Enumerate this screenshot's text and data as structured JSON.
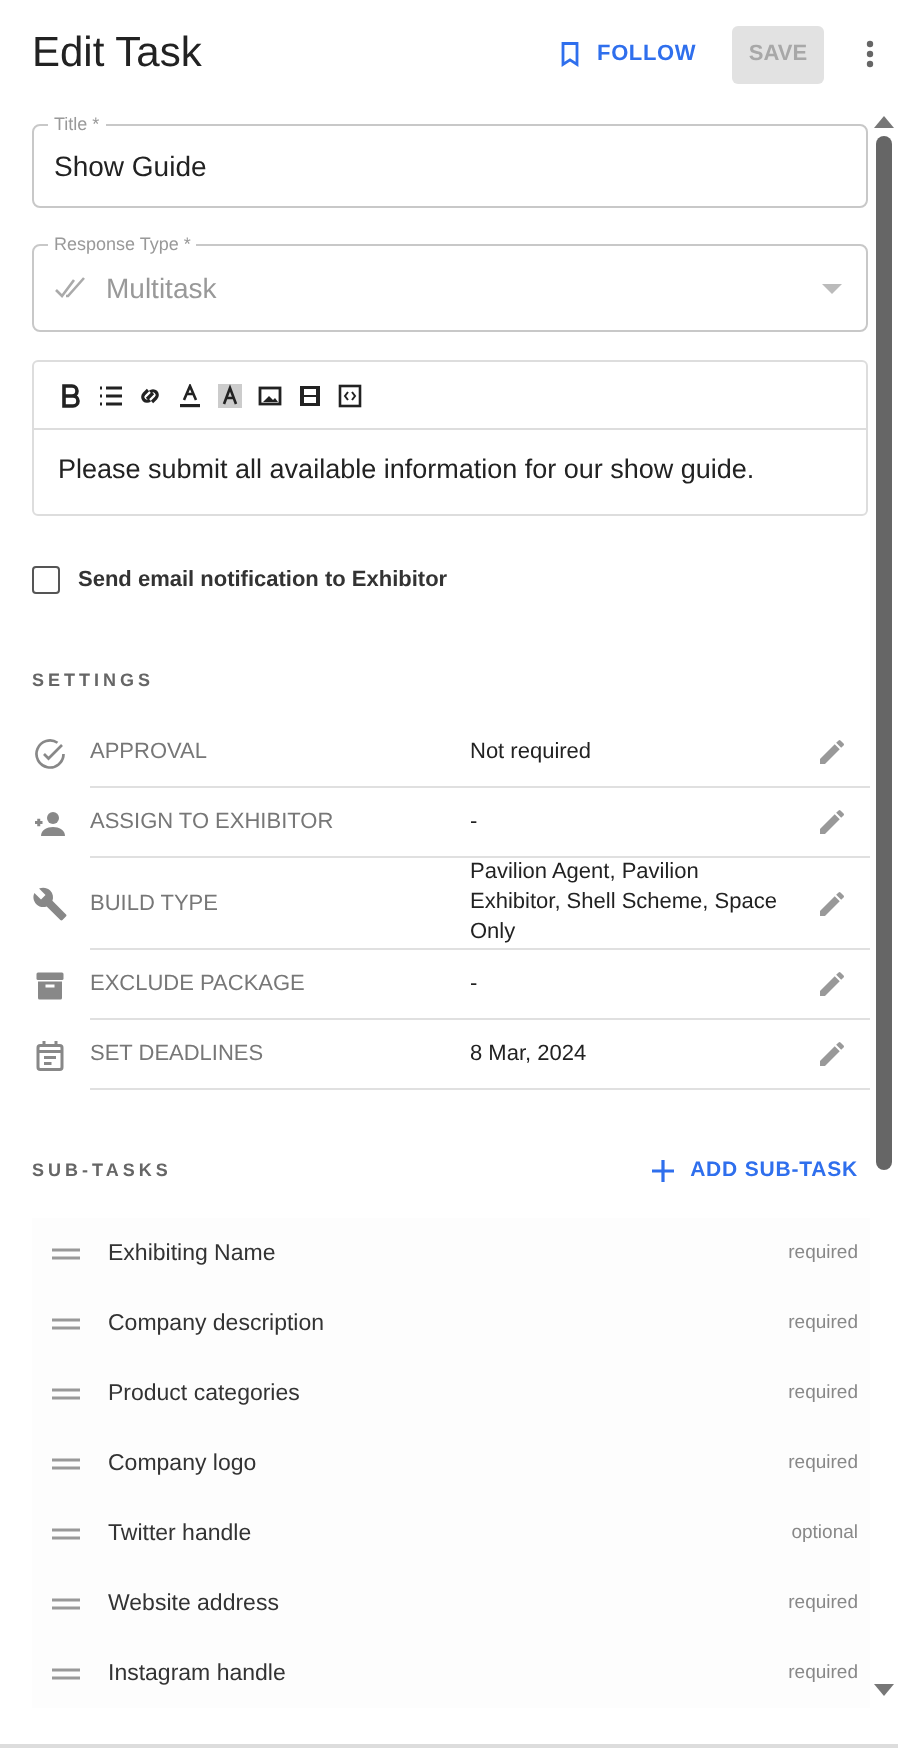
{
  "header": {
    "title": "Edit Task",
    "follow": "FOLLOW",
    "save": {
      "label": "SAVE",
      "disabled": true
    }
  },
  "title_field": {
    "label": "Title *",
    "value": "Show Guide"
  },
  "response_type": {
    "label": "Response Type *",
    "value": "Multitask",
    "disabled": true
  },
  "description": "Please submit all available information for our show guide.",
  "notify": {
    "label": "Send email notification to Exhibitor",
    "checked": false
  },
  "settings": {
    "heading": "SETTINGS",
    "rows": [
      {
        "label": "APPROVAL",
        "value": "Not required"
      },
      {
        "label": "ASSIGN TO EXHIBITOR",
        "value": "-"
      },
      {
        "label": "BUILD TYPE",
        "value": "Pavilion Agent, Pavilion Exhibitor, Shell Scheme, Space Only"
      },
      {
        "label": "EXCLUDE PACKAGE",
        "value": "-"
      },
      {
        "label": "SET DEADLINES",
        "value": "8 Mar, 2024"
      }
    ]
  },
  "subtasks": {
    "heading": "SUB-TASKS",
    "add": "ADD SUB-TASK",
    "items": [
      {
        "name": "Exhibiting Name",
        "status": "required"
      },
      {
        "name": "Company description",
        "status": "required"
      },
      {
        "name": "Product categories",
        "status": "required"
      },
      {
        "name": "Company logo",
        "status": "required"
      },
      {
        "name": "Twitter handle",
        "status": "optional"
      },
      {
        "name": "Website address",
        "status": "required"
      },
      {
        "name": "Instagram handle",
        "status": "required"
      }
    ]
  }
}
